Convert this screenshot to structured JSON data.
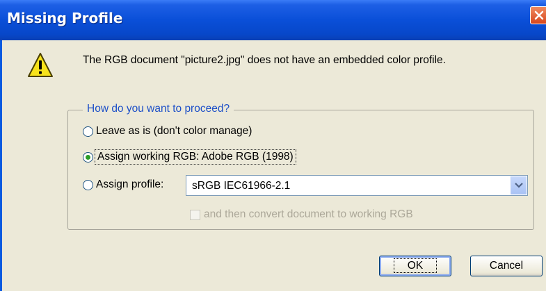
{
  "dialog": {
    "title": "Missing Profile",
    "message": "The RGB document \"picture2.jpg\" does not have an embedded color profile.",
    "group_label": "How do you want to proceed?",
    "options": [
      {
        "label": "Leave as is (don't color manage)",
        "checked": false
      },
      {
        "label": "Assign working RGB:  Adobe RGB (1998)",
        "checked": true
      },
      {
        "label": "Assign profile:",
        "checked": false
      }
    ],
    "profile_select": {
      "value": "sRGB IEC61966-2.1"
    },
    "convert_checkbox": {
      "label": "and then convert document to working RGB",
      "checked": false,
      "enabled": false
    },
    "buttons": {
      "ok": "OK",
      "cancel": "Cancel"
    }
  },
  "colors": {
    "titlebar": "#0a4fd8",
    "dialog_bg": "#ece9d8",
    "group_label": "#1c4fc8",
    "close_button": "#d6461d"
  },
  "icons": [
    "close-icon",
    "warning-icon",
    "chevron-down-icon"
  ]
}
